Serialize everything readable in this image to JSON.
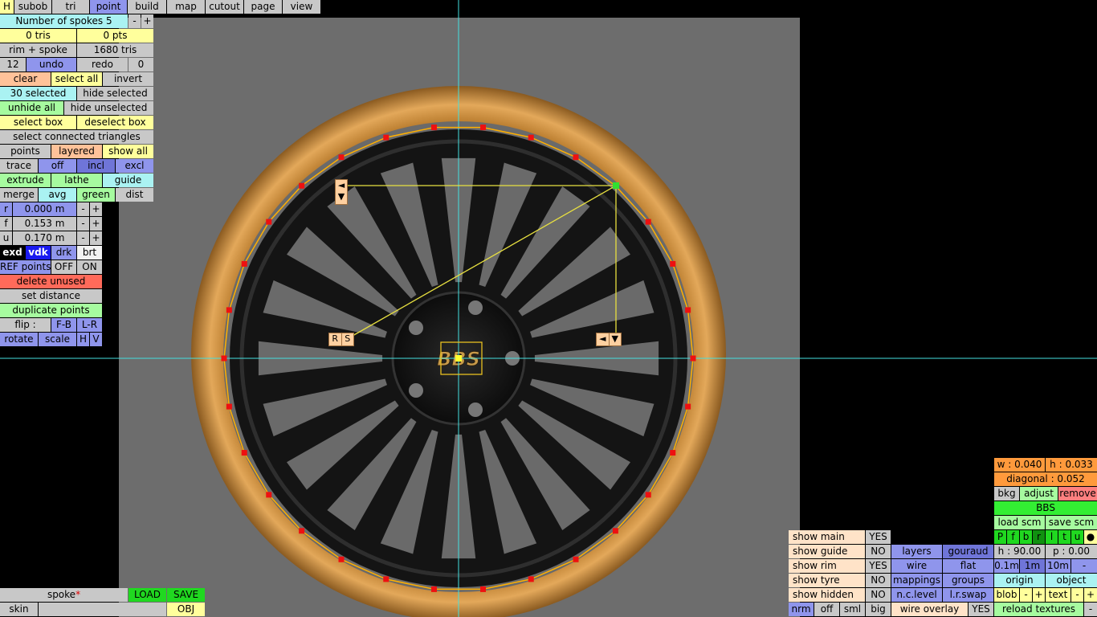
{
  "top_menu": [
    "H",
    "subob",
    "tri",
    "point",
    "build",
    "map",
    "cutout",
    "page",
    "view"
  ],
  "active_menu": "point",
  "left": {
    "spokes": "Number of spokes 5",
    "minus": "-",
    "plus": "+",
    "tris": "0 tris",
    "pts": "0 pts",
    "rim_spoke": "rim + spoke",
    "tris_total": "1680 tris",
    "undo_count": "12",
    "undo": "undo",
    "redo": "redo",
    "redo_count": "0",
    "clear": "clear",
    "select_all": "select all",
    "invert": "invert",
    "selected": "30 selected",
    "hide_selected": "hide selected",
    "unhide_all": "unhide all",
    "hide_unselected": "hide unselected",
    "select_box": "select box",
    "deselect_box": "deselect box",
    "select_connected": "select connected triangles",
    "points": "points",
    "layered": "layered",
    "show_all": "show all",
    "trace": "trace",
    "off": "off",
    "incl": "incl",
    "excl": "excl",
    "extrude": "extrude",
    "lathe": "lathe",
    "guide": "guide",
    "merge": "merge",
    "avg": "avg",
    "green": "green",
    "dist": "dist",
    "r_label": "r",
    "r_val": "0.000 m",
    "f_label": "f",
    "f_val": "0.153 m",
    "u_label": "u",
    "u_val": "0.170 m",
    "exd": "exd",
    "vdk": "vdk",
    "drk": "drk",
    "brt": "brt",
    "ref_points": "REF points",
    "ref_off": "OFF",
    "ref_on": "ON",
    "delete_unused": "delete unused",
    "set_distance": "set distance",
    "duplicate_points": "duplicate points",
    "flip": "flip :",
    "fb": "F-B",
    "lr": "L-R",
    "rotate": "rotate",
    "scale": "scale",
    "h": "H",
    "v": "V"
  },
  "bottom_left": {
    "object_name": "spoke",
    "star": "*",
    "load": "LOAD",
    "save": "SAVE",
    "skin": "skin",
    "obj": "OBJ"
  },
  "handles": {
    "rs_r": "R",
    "rs_s": "S",
    "left_arrow": "◄",
    "down_arrow": "▼"
  },
  "right_panel": {
    "w": "w : 0.040",
    "h": "h : 0.033",
    "diagonal": "diagonal : 0.052",
    "bkg": "bkg",
    "adjust": "adjust",
    "remove": "remove",
    "bbs": "BBS",
    "load_scm": "load scm",
    "save_scm": "save scm",
    "letters": [
      "P",
      "f",
      "b",
      "r",
      "l",
      "t",
      "u",
      "●"
    ],
    "h90": "h : 90.00",
    "p0": "p : 0.00",
    "m01": "0.1m",
    "m1": "1m",
    "m10": "10m",
    "minus": "-",
    "origin": "origin",
    "object": "object",
    "blob": "blob",
    "text": "text",
    "plus": "+",
    "reload": "reload textures"
  },
  "show_panel": {
    "show_main": "show main",
    "show_main_v": "YES",
    "show_guide": "show guide",
    "show_guide_v": "NO",
    "show_rim": "show rim",
    "show_rim_v": "YES",
    "show_tyre": "show tyre",
    "show_tyre_v": "NO",
    "show_hidden": "show hidden",
    "show_hidden_v": "NO",
    "layers": "layers",
    "gouraud": "gouraud",
    "wire": "wire",
    "flat": "flat",
    "mappings": "mappings",
    "groups": "groups",
    "nclevel": "n.c.level",
    "lrswap": "l.r.swap",
    "nrm": "nrm",
    "off": "off",
    "sml": "sml",
    "big": "big",
    "wire_overlay": "wire overlay",
    "wire_overlay_v": "YES"
  },
  "wheel_logo": "BBS"
}
